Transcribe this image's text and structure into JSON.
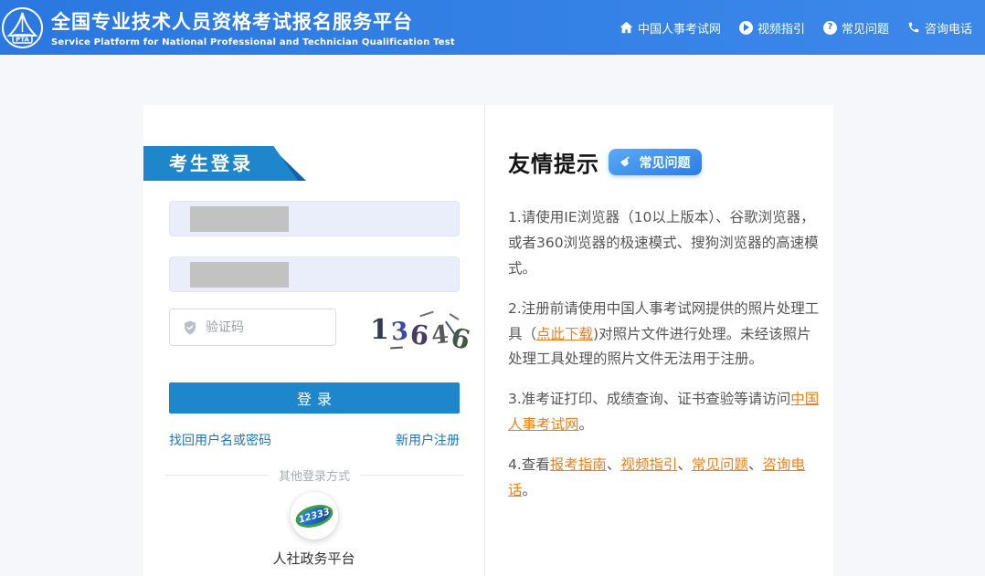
{
  "header": {
    "title": "全国专业技术人员资格考试报名服务平台",
    "subtitle": "Service Platform for National Professional and Technician Qualification Test",
    "logo_text": "PTA",
    "nav": [
      {
        "icon": "home-icon",
        "label": "中国人事考试网"
      },
      {
        "icon": "play-icon",
        "label": "视频指引"
      },
      {
        "icon": "question-icon",
        "label": "常见问题"
      },
      {
        "icon": "phone-icon",
        "label": "咨询电话"
      }
    ]
  },
  "login": {
    "panel_title": "考生登录",
    "captcha_placeholder": "验证码",
    "captcha_digits": [
      "1",
      "3",
      "6",
      "4",
      "6"
    ],
    "login_button": "登录",
    "forgot_link": "找回用户名或密码",
    "register_link": "新用户注册",
    "other_login_divider": "其他登录方式",
    "alt_login": {
      "logo_text": "12333",
      "label": "人社政务平台"
    }
  },
  "tips": {
    "title": "友情提示",
    "faq_button": "常见问题",
    "items": [
      {
        "segments": [
          {
            "text": "1.请使用IE浏览器（10以上版本）、谷歌浏览器，或者360浏览器的极速模式、搜狗浏览器的高速模式。",
            "link": false
          }
        ]
      },
      {
        "segments": [
          {
            "text": "2.注册前请使用中国人事考试网提供的照片处理工具（",
            "link": false
          },
          {
            "text": "点此下载",
            "link": true
          },
          {
            "text": ")对照片文件进行处理。未经该照片处理工具处理的照片文件无法用于注册。",
            "link": false
          }
        ]
      },
      {
        "segments": [
          {
            "text": "3.准考证打印、成绩查询、证书查验等请访问",
            "link": false
          },
          {
            "text": "中国人事考试网",
            "link": true
          },
          {
            "text": "。",
            "link": false
          }
        ]
      },
      {
        "segments": [
          {
            "text": "4.查看",
            "link": false
          },
          {
            "text": "报考指南",
            "link": true
          },
          {
            "text": "、",
            "link": false
          },
          {
            "text": "视频指引",
            "link": true
          },
          {
            "text": "、",
            "link": false
          },
          {
            "text": "常见问题",
            "link": true
          },
          {
            "text": "、",
            "link": false
          },
          {
            "text": "咨询电话",
            "link": true
          },
          {
            "text": "。",
            "link": false
          }
        ]
      }
    ]
  },
  "colors": {
    "header_blue": "#3180e4",
    "accent_blue": "#1e87cc",
    "link_blue": "#1a75c5",
    "link_orange": "#f07f1a",
    "field_bg": "#e9eefa",
    "page_bg": "#f6f7fa"
  }
}
